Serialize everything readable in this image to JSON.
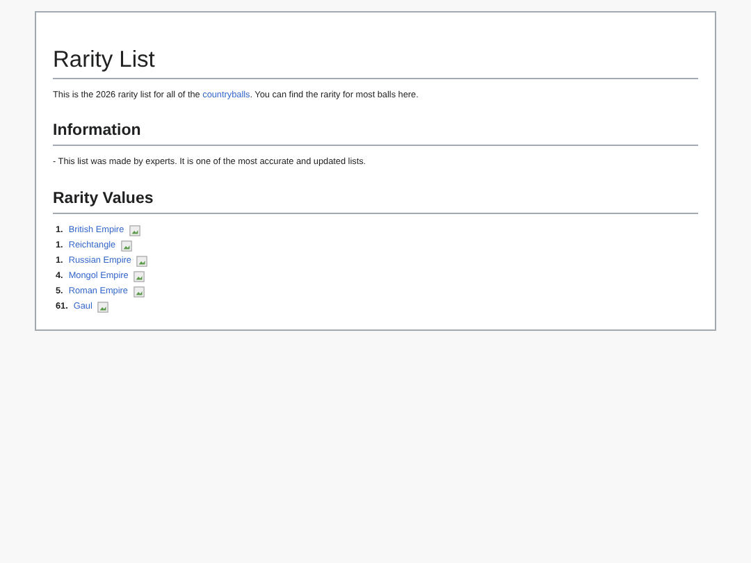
{
  "title": "Rarity List",
  "intro": {
    "before": "This is the 2026 rarity list for all of the ",
    "link": "countryballs",
    "after": ". You can find the rarity for most balls here."
  },
  "sections": [
    {
      "heading": "Information",
      "text": "- This list was made by experts. It is one of the most accurate and updated lists."
    },
    {
      "heading": "Rarity Values",
      "items": [
        {
          "rank": "1.",
          "name": "British Empire"
        },
        {
          "rank": "1.",
          "name": "Reichtangle"
        },
        {
          "rank": "1.",
          "name": "Russian Empire"
        },
        {
          "rank": "4.",
          "name": "Mongol Empire"
        },
        {
          "rank": "5.",
          "name": "Roman Empire"
        },
        {
          "rank": "61.",
          "name": "Gaul"
        }
      ]
    }
  ]
}
